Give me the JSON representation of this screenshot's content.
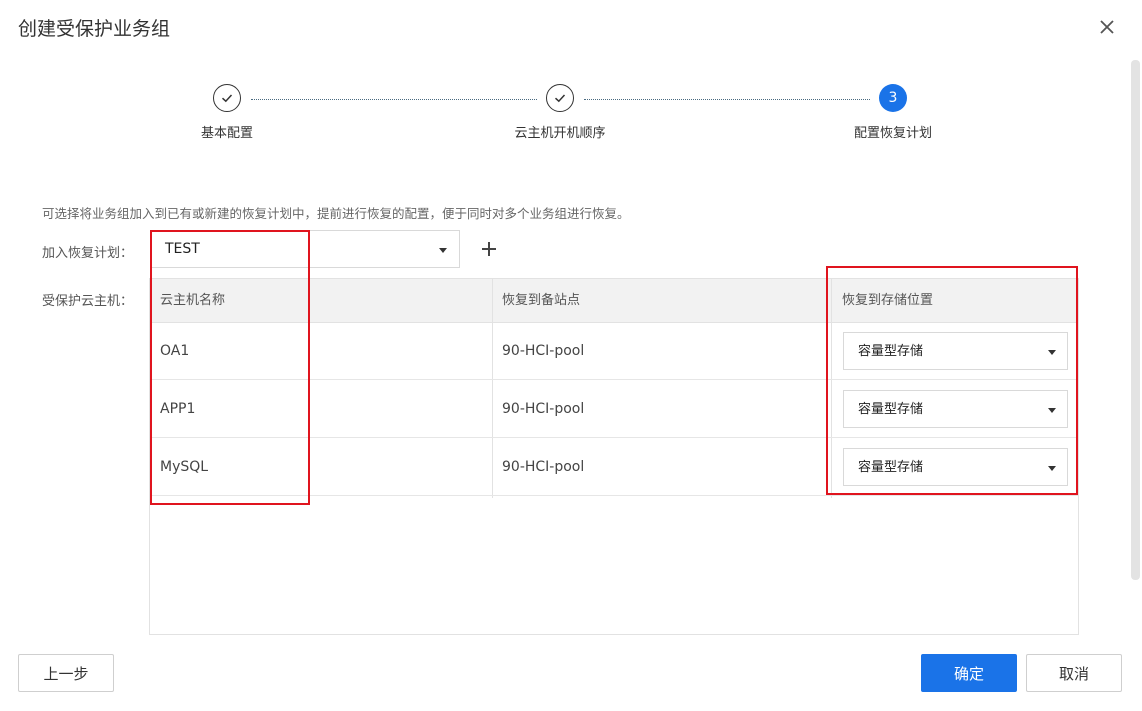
{
  "dialog": {
    "title": "创建受保护业务组"
  },
  "steps": [
    {
      "label": "基本配置",
      "state": "done"
    },
    {
      "label": "云主机开机顺序",
      "state": "done"
    },
    {
      "label": "配置恢复计划",
      "state": "active",
      "number": "3"
    }
  ],
  "hint": "可选择将业务组加入到已有或新建的恢复计划中，提前进行恢复的配置，便于同时对多个业务组进行恢复。",
  "form": {
    "plan_label": "加入恢复计划：",
    "plan_value": "TEST",
    "vm_label": "受保护云主机："
  },
  "table": {
    "headers": [
      "云主机名称",
      "恢复到备站点",
      "恢复到存储位置"
    ],
    "rows": [
      {
        "name": "OA1",
        "site": "90-HCI-pool",
        "storage": "容量型存储"
      },
      {
        "name": "APP1",
        "site": "90-HCI-pool",
        "storage": "容量型存储"
      },
      {
        "name": "MySQL",
        "site": "90-HCI-pool",
        "storage": "容量型存储"
      }
    ]
  },
  "footer": {
    "prev": "上一步",
    "confirm": "确定",
    "cancel": "取消"
  },
  "colors": {
    "primary": "#1a73e8",
    "highlight": "#e0141e"
  }
}
